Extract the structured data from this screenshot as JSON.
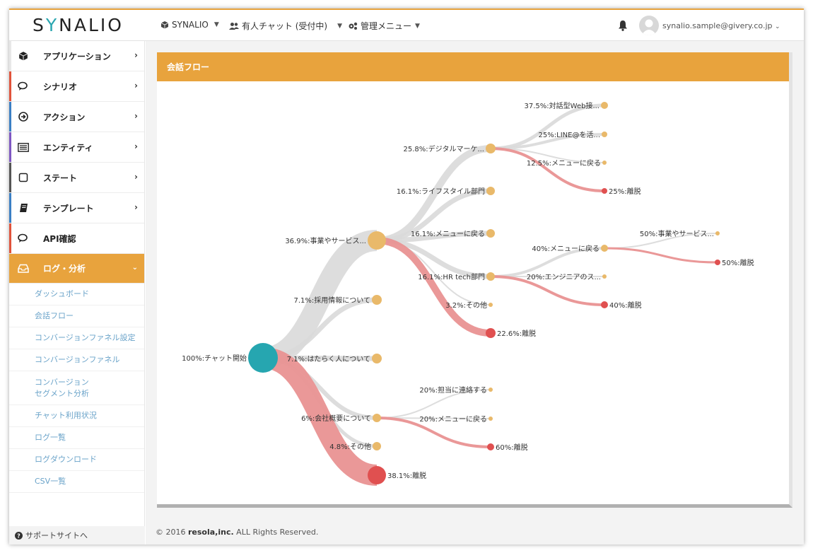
{
  "app": {
    "logo_prefix": "S",
    "logo_y": "Y",
    "logo_suffix": "NALIO"
  },
  "header": {
    "app_menu": "SYNALIO",
    "chat_menu": "有人チャット (受付中)",
    "admin_menu": "管理メニュー",
    "user_email": "synalio.sample@givery.co.jp"
  },
  "sidebar": {
    "items": [
      {
        "label": "アプリケーション",
        "icon": "cube-icon",
        "color": "#7e57c2"
      },
      {
        "label": "シナリオ",
        "icon": "chat-icon",
        "color": "#e0533b"
      },
      {
        "label": "アクション",
        "icon": "arrow-circle-icon",
        "color": "#3b7fc4"
      },
      {
        "label": "エンティティ",
        "icon": "list-icon",
        "color": "#7e57c2"
      },
      {
        "label": "ステート",
        "icon": "square-icon",
        "color": "#666666"
      },
      {
        "label": "テンプレート",
        "icon": "book-icon",
        "color": "#3b7fc4"
      },
      {
        "label": "API確認",
        "icon": "chat-icon",
        "color": "#e0533b"
      },
      {
        "label": "ログ・分析",
        "icon": "inbox-icon",
        "color": "#e8a33d"
      }
    ],
    "subitems": [
      "ダッシュボード",
      "会話フロー",
      "コンバージョンファネル設定",
      "コンバージョンファネル",
      "コンバージョン",
      "セグメント分析",
      "チャット利用状況",
      "ログ一覧",
      "ログダウンロード",
      "CSV一覧"
    ],
    "support": "サポートサイトへ"
  },
  "panel": {
    "title": "会話フロー"
  },
  "flow": {
    "nodes": {
      "root": "100%:チャット開始",
      "n_biz": "36.9%:事業やサービス...",
      "n_recruit": "7.1%:採用情報について",
      "n_people": "7.1%:はたらく人について",
      "n_company": "6%:会社概要について",
      "n_other": "4.8%:その他",
      "n_drop": "38.1%:離脱",
      "n_digital": "25.8%:デジタルマーケ...",
      "n_life": "16.1%:ライフスタイル部門",
      "n_menu": "16.1%:メニューに戻る",
      "n_hr": "16.1%:HR tech部門",
      "n_other2": "3.2%:その他",
      "n_drop2": "22.6%:離脱",
      "n_web": "37.5%:対話型Web接...",
      "n_line": "25%:LINE@を活...",
      "n_menu2": "12.5%:メニューに戻る",
      "n_drop3": "25%:離脱",
      "n_menu3": "40%:メニューに戻る",
      "n_eng": "20%:エンジニアのス...",
      "n_drop4": "40%:離脱",
      "n_biz2": "50%:事業やサービス...",
      "n_drop5": "50%:離脱",
      "n_contact": "20%:担当に連絡する",
      "n_menu4": "20%:メニューに戻る",
      "n_drop6": "60%:離脱"
    }
  },
  "footer": {
    "prefix": "© 2016",
    "company": "resola,inc.",
    "suffix": "ALL Rights Reserved."
  },
  "colors": {
    "accent": "#e8a33d",
    "root": "#26a6b0",
    "node": "#e9b96a",
    "drop": "#e05050",
    "link": "#d9d9d9",
    "drop_link": "#e99292"
  }
}
